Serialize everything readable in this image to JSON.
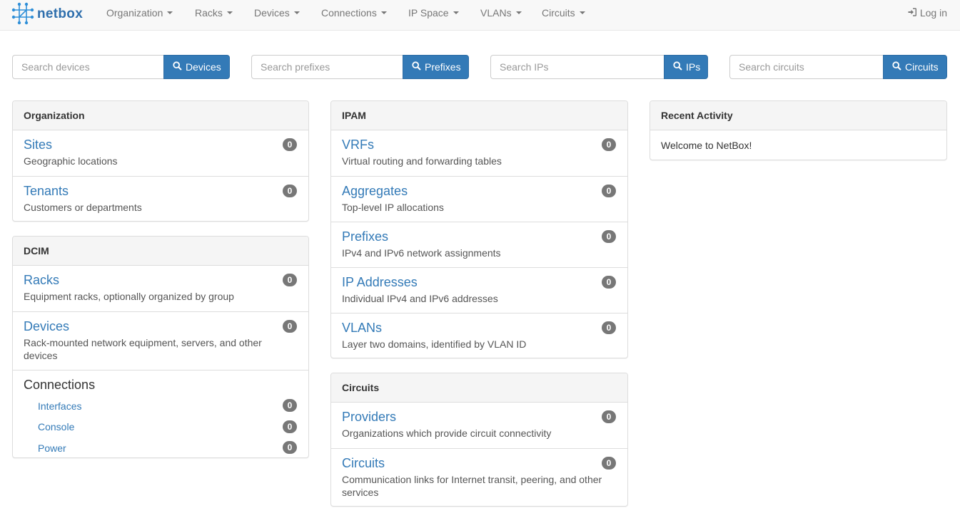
{
  "navbar": {
    "brand": "netbox",
    "menus": [
      {
        "label": "Organization"
      },
      {
        "label": "Racks"
      },
      {
        "label": "Devices"
      },
      {
        "label": "Connections"
      },
      {
        "label": "IP Space"
      },
      {
        "label": "VLANs"
      },
      {
        "label": "Circuits"
      }
    ],
    "login": "Log in"
  },
  "searches": [
    {
      "placeholder": "Search devices",
      "button": "Devices"
    },
    {
      "placeholder": "Search prefixes",
      "button": "Prefixes"
    },
    {
      "placeholder": "Search IPs",
      "button": "IPs"
    },
    {
      "placeholder": "Search circuits",
      "button": "Circuits"
    }
  ],
  "organization": {
    "heading": "Organization",
    "items": [
      {
        "title": "Sites",
        "desc": "Geographic locations",
        "count": "0"
      },
      {
        "title": "Tenants",
        "desc": "Customers or departments",
        "count": "0"
      }
    ]
  },
  "dcim": {
    "heading": "DCIM",
    "items": [
      {
        "title": "Racks",
        "desc": "Equipment racks, optionally organized by group",
        "count": "0"
      },
      {
        "title": "Devices",
        "desc": "Rack-mounted network equipment, servers, and other devices",
        "count": "0"
      }
    ],
    "connections": {
      "title": "Connections",
      "items": [
        {
          "label": "Interfaces",
          "count": "0"
        },
        {
          "label": "Console",
          "count": "0"
        },
        {
          "label": "Power",
          "count": "0"
        }
      ]
    }
  },
  "ipam": {
    "heading": "IPAM",
    "items": [
      {
        "title": "VRFs",
        "desc": "Virtual routing and forwarding tables",
        "count": "0"
      },
      {
        "title": "Aggregates",
        "desc": "Top-level IP allocations",
        "count": "0"
      },
      {
        "title": "Prefixes",
        "desc": "IPv4 and IPv6 network assignments",
        "count": "0"
      },
      {
        "title": "IP Addresses",
        "desc": "Individual IPv4 and IPv6 addresses",
        "count": "0"
      },
      {
        "title": "VLANs",
        "desc": "Layer two domains, identified by VLAN ID",
        "count": "0"
      }
    ]
  },
  "circuits": {
    "heading": "Circuits",
    "items": [
      {
        "title": "Providers",
        "desc": "Organizations which provide circuit connectivity",
        "count": "0"
      },
      {
        "title": "Circuits",
        "desc": "Communication links for Internet transit, peering, and other services",
        "count": "0"
      }
    ]
  },
  "activity": {
    "heading": "Recent Activity",
    "message": "Welcome to NetBox!"
  },
  "icons": {
    "brand": "netbox-logo-icon",
    "search": "search-icon",
    "login": "sign-in-icon"
  },
  "colors": {
    "primary": "#337ab7",
    "badge": "#777777",
    "navbar": "#f8f8f8"
  }
}
